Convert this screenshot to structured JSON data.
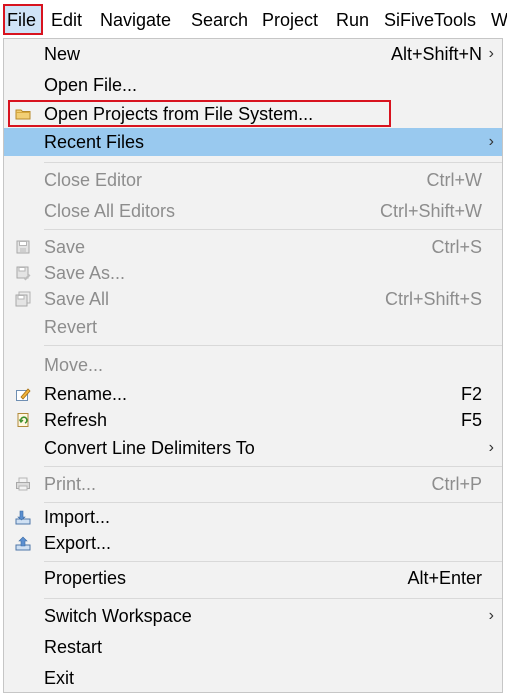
{
  "menubar": {
    "items": [
      "File",
      "Edit",
      "Navigate",
      "Search",
      "Project",
      "Run",
      "SiFiveTools",
      "W"
    ]
  },
  "menu": {
    "items": [
      {
        "label": "New",
        "shortcut": "Alt+Shift+N",
        "submenu": true
      },
      {
        "label": "Open File...",
        "shortcut": ""
      },
      {
        "label": "Open Projects from File System...",
        "shortcut": "",
        "icon": "folder-icon"
      },
      {
        "label": "Recent Files",
        "shortcut": "",
        "submenu": true,
        "highlighted": true
      },
      {
        "label": "Close Editor",
        "shortcut": "Ctrl+W",
        "disabled": true
      },
      {
        "label": "Close All Editors",
        "shortcut": "Ctrl+Shift+W",
        "disabled": true
      },
      {
        "label": "Save",
        "shortcut": "Ctrl+S",
        "disabled": true,
        "icon": "save-icon"
      },
      {
        "label": "Save As...",
        "shortcut": "",
        "disabled": true,
        "icon": "save-as-icon"
      },
      {
        "label": "Save All",
        "shortcut": "Ctrl+Shift+S",
        "disabled": true,
        "icon": "save-all-icon"
      },
      {
        "label": "Revert",
        "shortcut": "",
        "disabled": true
      },
      {
        "label": "Move...",
        "shortcut": "",
        "disabled": true
      },
      {
        "label": "Rename...",
        "shortcut": "F2",
        "icon": "rename-icon"
      },
      {
        "label": "Refresh",
        "shortcut": "F5",
        "icon": "refresh-icon"
      },
      {
        "label": "Convert Line Delimiters To",
        "shortcut": "",
        "submenu": true
      },
      {
        "label": "Print...",
        "shortcut": "Ctrl+P",
        "disabled": true,
        "icon": "print-icon"
      },
      {
        "label": "Import...",
        "shortcut": "",
        "icon": "import-icon"
      },
      {
        "label": "Export...",
        "shortcut": "",
        "icon": "export-icon"
      },
      {
        "label": "Properties",
        "shortcut": "Alt+Enter"
      },
      {
        "label": "Switch Workspace",
        "shortcut": "",
        "submenu": true
      },
      {
        "label": "Restart",
        "shortcut": ""
      },
      {
        "label": "Exit",
        "shortcut": ""
      }
    ],
    "submenu_arrow": "›"
  },
  "colors": {
    "highlight": "#99c9ef",
    "annotation_red": "#d8131f",
    "disabled_text": "#8d8d8d"
  }
}
